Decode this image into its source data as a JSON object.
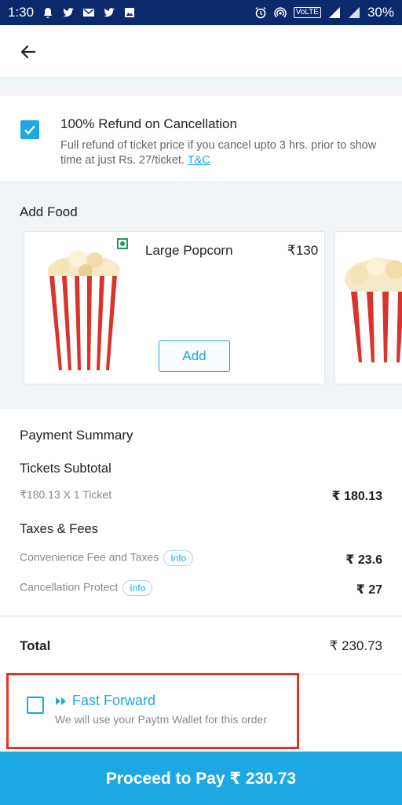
{
  "status_bar": {
    "time": "1:30",
    "network": "VoLTE",
    "signal": "4G",
    "battery": "30%"
  },
  "refund": {
    "title": "100% Refund on Cancellation",
    "description": "Full refund of ticket price if you cancel upto 3 hrs. prior to show time at just Rs. 27/ticket.",
    "link": "T&C",
    "checked": true
  },
  "food": {
    "section_title": "Add Food",
    "item_name": "Large Popcorn",
    "item_price": "₹130",
    "add_label": "Add"
  },
  "payment": {
    "title": "Payment Summary",
    "tickets_heading": "Tickets Subtotal",
    "ticket_line_label": "₹180.13 X 1 Ticket",
    "ticket_line_value": "₹ 180.13",
    "taxes_heading": "Taxes & Fees",
    "convenience_label": "Convenience Fee and Taxes",
    "convenience_value": "₹ 23.6",
    "cancellation_label": "Cancellation Protect",
    "cancellation_value": "₹ 27",
    "info_label": "Info"
  },
  "total": {
    "label": "Total",
    "value": "₹ 230.73"
  },
  "fast_forward": {
    "title": "Fast Forward",
    "subtitle": "We will use your Paytm Wallet for this order",
    "checked": false
  },
  "proceed": {
    "label": "Proceed to Pay ₹ 230.73"
  },
  "colors": {
    "accent": "#1ea8e3",
    "status_bar": "#0b2a6b",
    "highlight_border": "#e8321e",
    "veg": "#1e9b5b"
  }
}
